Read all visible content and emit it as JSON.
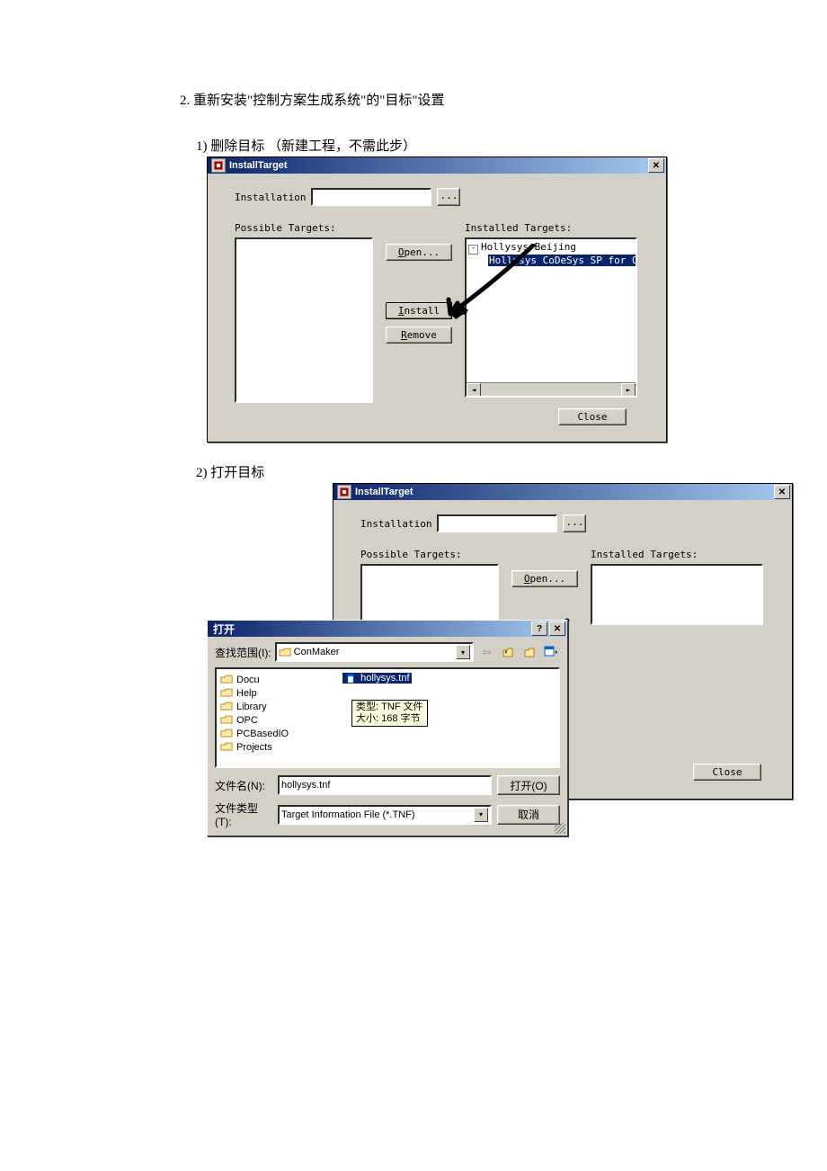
{
  "doc": {
    "step_main": "2.   重新安装\"控制方案生成系统\"的\"目标\"设置",
    "sub1": "1) 删除目标   （新建工程，不需此步）",
    "sub2": "2) 打开目标"
  },
  "dlg1": {
    "title": "InstallTarget",
    "installation_label": "Installation",
    "browse_btn": "...",
    "possible_label": "Possible Targets:",
    "installed_label": "Installed Targets:",
    "open_btn": "Open...",
    "install_btn": "Install",
    "remove_btn": "Remove",
    "close_btn": "Close",
    "tree_root": "Hollysys Beijing",
    "tree_child": "Hollysys CoDeSys SP for Q"
  },
  "dlg2": {
    "title": "InstallTarget",
    "installation_label": "Installation",
    "browse_btn": "...",
    "possible_label": "Possible Targets:",
    "installed_label": "Installed Targets:",
    "open_btn": "Open...",
    "close_btn": "Close"
  },
  "open": {
    "title": "打开",
    "lookin_label": "查找范围(I):",
    "lookin_value": "ConMaker",
    "folders": [
      "Docu",
      "Help",
      "Library",
      "OPC",
      "PCBasedIO",
      "Projects"
    ],
    "sel_file": "hollysys.tnf",
    "tooltip_l1": "类型: TNF 文件",
    "tooltip_l2": "大小: 168 字节",
    "filename_label": "文件名(N):",
    "filename_value": "hollysys.tnf",
    "filetype_label": "文件类型(T):",
    "filetype_value": "Target Information File (*.TNF)",
    "open_btn": "打开(O)",
    "cancel_btn": "取消"
  }
}
